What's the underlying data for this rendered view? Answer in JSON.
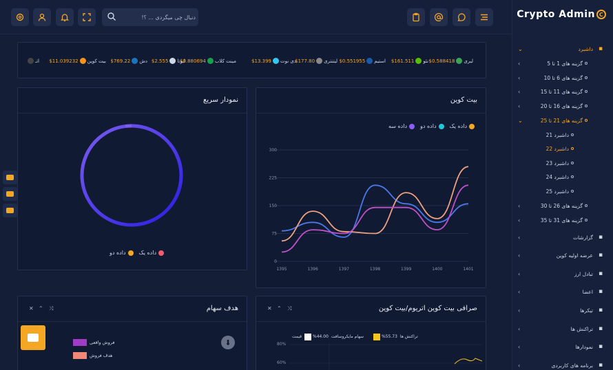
{
  "brand": {
    "name": "Crypto Admin",
    "mark": "C"
  },
  "search": {
    "placeholder": "دنبال چی میگردی ... ؟!"
  },
  "topbar": {
    "left_icons": [
      "gear-icon",
      "user-icon",
      "bell-icon",
      "fullscreen-icon"
    ],
    "right_icons": [
      "clipboard-icon",
      "at-sign-icon",
      "chat-icon",
      "menu-icon"
    ],
    "accent": "#f5a623"
  },
  "sidebar": {
    "items": [
      {
        "label": "داشبرد",
        "icon": "monitor-icon",
        "active": true,
        "expanded": true
      },
      {
        "label": "گزینه های 1 تا 5",
        "level": 2
      },
      {
        "label": "گزینه های 6 تا 10",
        "level": 2
      },
      {
        "label": "گزینه های 11 تا 15",
        "level": 2
      },
      {
        "label": "گزینه های 16 تا 20",
        "level": 2
      },
      {
        "label": "گزینه های 21 تا 25",
        "level": 2,
        "active": true,
        "expanded": true
      },
      {
        "label": "داشبرد 21",
        "level": 3
      },
      {
        "label": "داشبرد 22",
        "level": 3,
        "active": true
      },
      {
        "label": "داشبرد 23",
        "level": 3
      },
      {
        "label": "داشبرد 24",
        "level": 3
      },
      {
        "label": "داشبرد 25",
        "level": 3
      },
      {
        "label": "گزینه های 26 تا 30",
        "level": 2
      },
      {
        "label": "گزینه های 31 تا 35",
        "level": 2
      },
      {
        "label": "گزارشات",
        "icon": "bar-chart-icon"
      },
      {
        "label": "عرضه اولیه کوین",
        "icon": "pie-chart-icon"
      },
      {
        "label": "تبادل ارز",
        "icon": "exchange-icon"
      },
      {
        "label": "اعضا",
        "icon": "users-icon"
      },
      {
        "label": "تیکرها",
        "icon": "sliders-icon"
      },
      {
        "label": "تراکنش ها",
        "icon": "dollar-icon"
      },
      {
        "label": "نمودارها",
        "icon": "pie-icon"
      },
      {
        "label": "برنامه های کاربردی",
        "icon": "grid-icon"
      }
    ]
  },
  "ticker": [
    {
      "name": "لیری",
      "price": "$0.588418",
      "color": "#3aa655"
    },
    {
      "name": "نئو",
      "price": "$161.511",
      "color": "#58bf00"
    },
    {
      "name": "استیم",
      "price": "$0.551955",
      "color": "#1a5aa8"
    },
    {
      "name": "لیتنتری",
      "price": "$177.80",
      "color": "#8a8a8a"
    },
    {
      "name": "دی نوت",
      "price": "$13.399",
      "color": "#33c7f0"
    },
    {
      "name": "مینت کلاب",
      "price": "$0.880694",
      "color": "#15a34a"
    },
    {
      "name": "ایوتا",
      "price": "$2.555",
      "color": "#cfd6e6"
    },
    {
      "name": "دش",
      "price": "$769.22",
      "color": "#1c75bc"
    },
    {
      "name": "بیت کوین",
      "price": "$11.039232",
      "color": "#f7931a"
    },
    {
      "name": "اتـ",
      "price": "",
      "color": "#444"
    }
  ],
  "bitcoin_panel": {
    "title": "بیت کوین",
    "legend": [
      {
        "label": "داده یک",
        "color": "#f5a623"
      },
      {
        "label": "داده دو",
        "color": "#26c6da"
      },
      {
        "label": "داده سه",
        "color": "#8e5cf7"
      }
    ]
  },
  "quick_chart": {
    "title": "نمودار سریع",
    "legend": [
      {
        "label": "داده یک",
        "color": "#f25c6d"
      },
      {
        "label": "داده دو",
        "color": "#f5a623"
      }
    ]
  },
  "chart_data": [
    {
      "type": "line",
      "title": "بیت کوین",
      "x": [
        "1395",
        "1396",
        "1397",
        "1398",
        "1399",
        "1400",
        "1401"
      ],
      "ylim": [
        0,
        300
      ],
      "yticks": [
        0,
        75,
        150,
        225,
        300
      ],
      "series": [
        {
          "name": "داده یک",
          "color": "#4a78e8",
          "values": [
            82,
            105,
            65,
            205,
            155,
            105,
            155
          ]
        },
        {
          "name": "داده دو",
          "color": "#f0a080",
          "values": [
            55,
            135,
            80,
            75,
            185,
            115,
            255
          ]
        },
        {
          "name": "داده سه",
          "color": "#c050c8",
          "values": [
            25,
            85,
            75,
            145,
            145,
            85,
            205
          ]
        }
      ]
    },
    {
      "type": "pie",
      "title": "نمودار سریع",
      "categories": [
        "داده یک",
        "داده دو"
      ],
      "values": [
        98,
        2
      ]
    }
  ],
  "stock_target": {
    "title": "هدف سهام",
    "legend": [
      {
        "label": "فروش واقعی",
        "color": "#a23cc8"
      },
      {
        "label": "هدف فروش",
        "color": "#f08878"
      }
    ]
  },
  "exchange_panel": {
    "title": "صرافی بیت کوین اتریوم/بیت کوین",
    "legend": [
      {
        "label": "تراکنش ها",
        "value": "55.73%",
        "color": "#f5c518"
      },
      {
        "label": "سهام مایکروسافت",
        "value": "44.00%",
        "color": "#ffffff"
      },
      {
        "label": "قیمت",
        "value": "",
        "color": "#cfd6e6"
      }
    ],
    "yticks": [
      "80%",
      "60%"
    ]
  }
}
